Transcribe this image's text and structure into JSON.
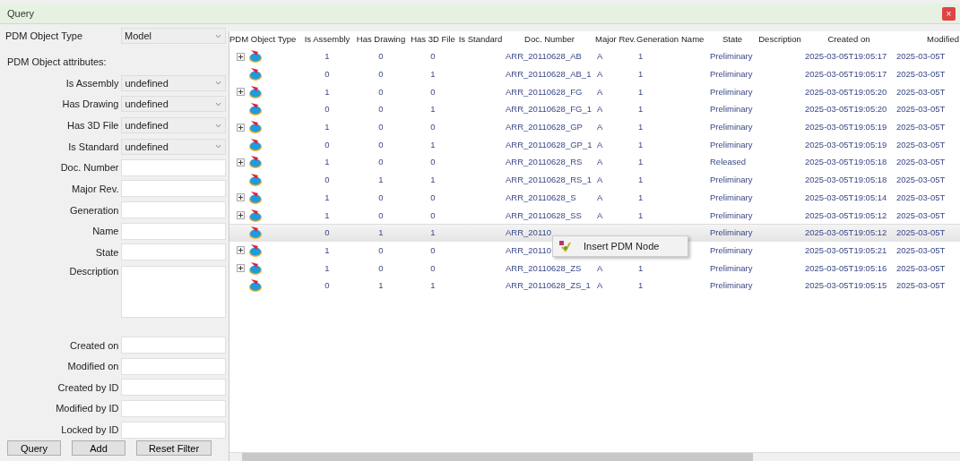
{
  "window": {
    "title": "Query",
    "close_label": "×"
  },
  "filter": {
    "type_label": "PDM Object Type",
    "type_value": "Model",
    "attributes_label": "PDM Object attributes:",
    "fields": [
      {
        "kind": "select",
        "label": "Is Assembly",
        "value": "undefined"
      },
      {
        "kind": "select",
        "label": "Has Drawing",
        "value": "undefined"
      },
      {
        "kind": "select",
        "label": "Has 3D File",
        "value": "undefined"
      },
      {
        "kind": "select",
        "label": "Is Standard",
        "value": "undefined"
      },
      {
        "kind": "text",
        "label": "Doc. Number"
      },
      {
        "kind": "text",
        "label": "Major Rev."
      },
      {
        "kind": "text",
        "label": "Generation"
      },
      {
        "kind": "text",
        "label": "Name"
      },
      {
        "kind": "text",
        "label": "State"
      },
      {
        "kind": "area",
        "label": "Description"
      },
      {
        "kind": "text",
        "label": "Created on"
      },
      {
        "kind": "text",
        "label": "Modified on"
      },
      {
        "kind": "text",
        "label": "Created by ID"
      },
      {
        "kind": "text",
        "label": "Modified by ID"
      },
      {
        "kind": "text",
        "label": "Locked by ID"
      }
    ],
    "buttons": [
      "Query",
      "Add",
      "Reset Filter"
    ]
  },
  "table": {
    "columns": [
      "PDM Object Type",
      "Is Assembly",
      "Has Drawing",
      "Has 3D File",
      "Is Standard",
      "Doc. Number",
      "Major Rev.",
      "Generation",
      "Name",
      "State",
      "Description",
      "Created on",
      "Modified"
    ],
    "rows": [
      {
        "expandable": true,
        "selected": false,
        "cells": [
          "",
          "1",
          "0",
          "0",
          "",
          "ARR_20110628_AB",
          "A",
          "1",
          "",
          "Preliminary",
          "",
          "2025-03-05T19:05:17",
          "2025-03-05T"
        ]
      },
      {
        "expandable": false,
        "selected": false,
        "cells": [
          "",
          "0",
          "0",
          "1",
          "",
          "ARR_20110628_AB_1",
          "A",
          "1",
          "",
          "Preliminary",
          "",
          "2025-03-05T19:05:17",
          "2025-03-05T"
        ]
      },
      {
        "expandable": true,
        "selected": false,
        "cells": [
          "",
          "1",
          "0",
          "0",
          "",
          "ARR_20110628_FG",
          "A",
          "1",
          "",
          "Preliminary",
          "",
          "2025-03-05T19:05:20",
          "2025-03-05T"
        ]
      },
      {
        "expandable": false,
        "selected": false,
        "cells": [
          "",
          "0",
          "0",
          "1",
          "",
          "ARR_20110628_FG_1",
          "A",
          "1",
          "",
          "Preliminary",
          "",
          "2025-03-05T19:05:20",
          "2025-03-05T"
        ]
      },
      {
        "expandable": true,
        "selected": false,
        "cells": [
          "",
          "1",
          "0",
          "0",
          "",
          "ARR_20110628_GP",
          "A",
          "1",
          "",
          "Preliminary",
          "",
          "2025-03-05T19:05:19",
          "2025-03-05T"
        ]
      },
      {
        "expandable": false,
        "selected": false,
        "cells": [
          "",
          "0",
          "0",
          "1",
          "",
          "ARR_20110628_GP_1",
          "A",
          "1",
          "",
          "Preliminary",
          "",
          "2025-03-05T19:05:19",
          "2025-03-05T"
        ]
      },
      {
        "expandable": true,
        "selected": false,
        "cells": [
          "",
          "1",
          "0",
          "0",
          "",
          "ARR_20110628_RS",
          "A",
          "1",
          "",
          "Released",
          "",
          "2025-03-05T19:05:18",
          "2025-03-05T"
        ]
      },
      {
        "expandable": false,
        "selected": false,
        "cells": [
          "",
          "0",
          "1",
          "1",
          "",
          "ARR_20110628_RS_1",
          "A",
          "1",
          "",
          "Preliminary",
          "",
          "2025-03-05T19:05:18",
          "2025-03-05T"
        ]
      },
      {
        "expandable": true,
        "selected": false,
        "cells": [
          "",
          "1",
          "0",
          "0",
          "",
          "ARR_20110628_S",
          "A",
          "1",
          "",
          "Preliminary",
          "",
          "2025-03-05T19:05:14",
          "2025-03-05T"
        ]
      },
      {
        "expandable": true,
        "selected": false,
        "cells": [
          "",
          "1",
          "0",
          "0",
          "",
          "ARR_20110628_SS",
          "A",
          "1",
          "",
          "Preliminary",
          "",
          "2025-03-05T19:05:12",
          "2025-03-05T"
        ]
      },
      {
        "expandable": false,
        "selected": true,
        "cells": [
          "",
          "0",
          "1",
          "1",
          "",
          "ARR_20110",
          "",
          "",
          "",
          "Preliminary",
          "",
          "2025-03-05T19:05:12",
          "2025-03-05T"
        ]
      },
      {
        "expandable": true,
        "selected": false,
        "cells": [
          "",
          "1",
          "0",
          "0",
          "",
          "ARR_20110",
          "",
          "",
          "",
          "Preliminary",
          "",
          "2025-03-05T19:05:21",
          "2025-03-05T"
        ]
      },
      {
        "expandable": true,
        "selected": false,
        "cells": [
          "",
          "1",
          "0",
          "0",
          "",
          "ARR_20110628_ZS",
          "A",
          "1",
          "",
          "Preliminary",
          "",
          "2025-03-05T19:05:16",
          "2025-03-05T"
        ]
      },
      {
        "expandable": false,
        "selected": false,
        "cells": [
          "",
          "0",
          "1",
          "1",
          "",
          "ARR_20110628_ZS_1",
          "A",
          "1",
          "",
          "Preliminary",
          "",
          "2025-03-05T19:05:15",
          "2025-03-05T"
        ]
      }
    ]
  },
  "context_menu": {
    "items": [
      "Insert PDM Node"
    ]
  }
}
